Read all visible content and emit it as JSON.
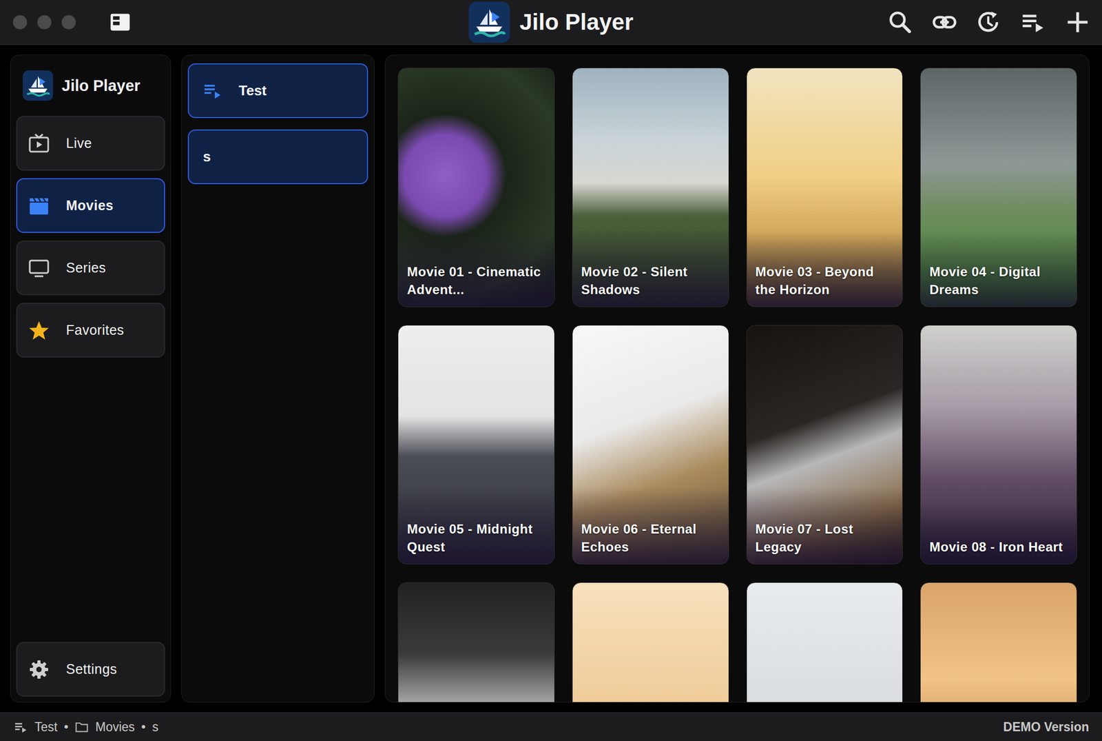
{
  "window": {
    "title": "Jilo Player"
  },
  "sidebar": {
    "title": "Jilo Player",
    "items": [
      {
        "label": "Live",
        "kind": "live",
        "selected": false
      },
      {
        "label": "Movies",
        "kind": "movies",
        "selected": true
      },
      {
        "label": "Series",
        "kind": "series",
        "selected": false
      },
      {
        "label": "Favorites",
        "kind": "favorites",
        "selected": false
      }
    ],
    "footer": {
      "label": "Settings",
      "selected": false
    }
  },
  "lists": [
    {
      "label": "Test",
      "kind": "playlist",
      "selected": true
    },
    {
      "label": "s",
      "kind": "category",
      "selected": true
    }
  ],
  "movies": [
    {
      "kind": "titled",
      "title": "Movie 01 - Cinematic Advent..."
    },
    {
      "kind": "titled",
      "title": "Movie 02 - Silent Shadows"
    },
    {
      "kind": "titled",
      "title": "Movie 03 - Beyond the Horizon"
    },
    {
      "kind": "titled",
      "title": "Movie 04 - Digital Dreams"
    },
    {
      "kind": "titled",
      "title": "Movie 05 - Midnight Quest"
    },
    {
      "kind": "titled",
      "title": "Movie 06 - Eternal Echoes"
    },
    {
      "kind": "titled",
      "title": "Movie 07 - Lost Legacy"
    },
    {
      "kind": "titled",
      "title": "Movie 08 - Iron Heart"
    },
    {
      "kind": "poster"
    },
    {
      "kind": "poster"
    },
    {
      "kind": "poster"
    },
    {
      "kind": "poster"
    }
  ],
  "status_bar": {
    "path": [
      {
        "label": "Test",
        "kind": "playlist"
      },
      {
        "label": "Movies",
        "kind": "folder"
      },
      {
        "label": "s",
        "kind": "plain"
      }
    ],
    "separator": "•",
    "edition": "DEMO Version"
  }
}
